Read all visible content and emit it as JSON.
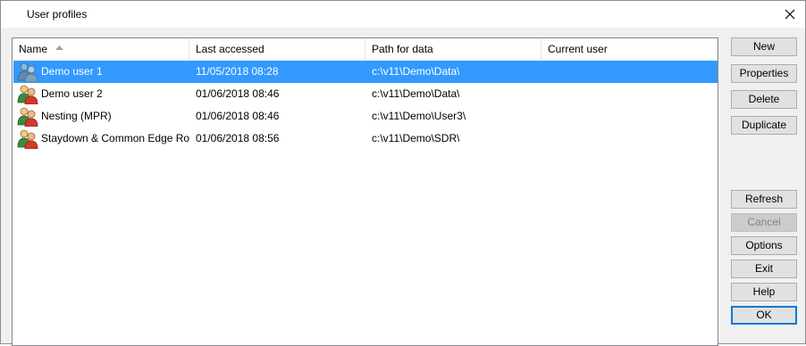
{
  "window": {
    "title": "User profiles"
  },
  "list": {
    "columns": [
      "Name",
      "Last accessed",
      "Path for data",
      "Current user"
    ],
    "rows": [
      {
        "name": "Demo user 1",
        "last_accessed": "11/05/2018 08:28",
        "path": "c:\\v11\\Demo\\Data\\",
        "current_user": "",
        "selected": true
      },
      {
        "name": "Demo user 2",
        "last_accessed": "01/06/2018 08:46",
        "path": "c:\\v11\\Demo\\Data\\",
        "current_user": "",
        "selected": false
      },
      {
        "name": "Nesting (MPR)",
        "last_accessed": "01/06/2018 08:46",
        "path": "c:\\v11\\Demo\\User3\\",
        "current_user": "",
        "selected": false
      },
      {
        "name": "Staydown & Common Edge Routi...",
        "last_accessed": "01/06/2018 08:56",
        "path": "c:\\v11\\Demo\\SDR\\",
        "current_user": "",
        "selected": false
      }
    ]
  },
  "buttons": {
    "new": "New",
    "properties": "Properties",
    "delete": "Delete",
    "duplicate": "Duplicate",
    "refresh": "Refresh",
    "cancel": "Cancel",
    "options": "Options",
    "exit": "Exit",
    "help": "Help",
    "ok": "OK"
  },
  "icons": {
    "close": "close-icon",
    "sort": "sort-ascending-icon",
    "user": "users-icon"
  },
  "colors": {
    "selection": "#3399ff",
    "default_button_border": "#0078d7"
  }
}
